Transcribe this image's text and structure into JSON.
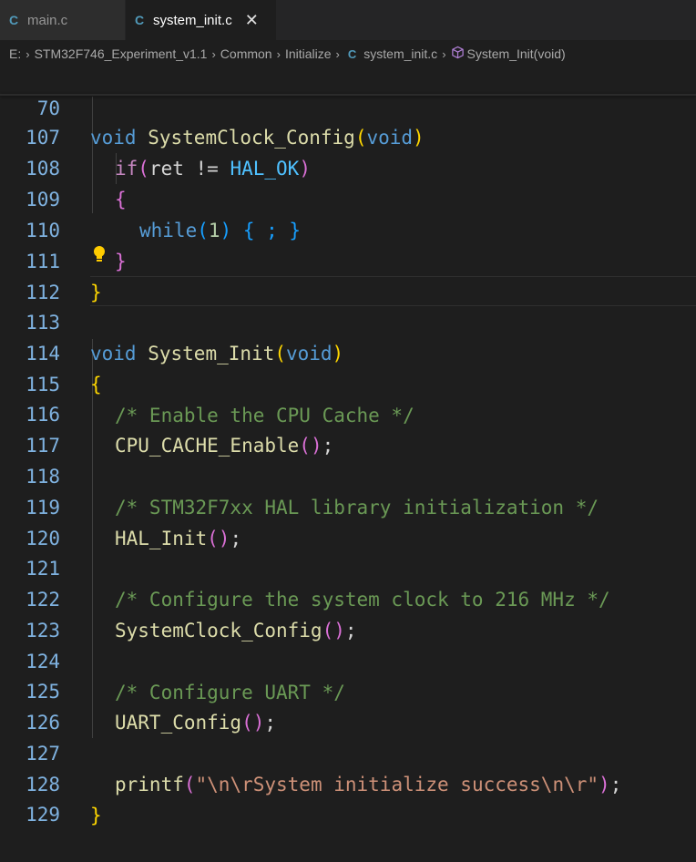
{
  "tabs": [
    {
      "icon": "C",
      "label": "main.c",
      "active": false
    },
    {
      "icon": "C",
      "label": "system_init.c",
      "active": true,
      "close": "✕"
    }
  ],
  "breadcrumb": {
    "drive": "E:",
    "folder1": "STM32F746_Experiment_v1.1",
    "folder2": "Common",
    "folder3": "Initialize",
    "file_icon": "C",
    "file": "system_init.c",
    "symbol": "System_Init(void)"
  },
  "editor": {
    "sticky": {
      "number": "70",
      "kw": "void",
      "fn": "SystemClock_Config",
      "lp": "(",
      "arg": "void",
      "rp": ")"
    },
    "lines": {
      "l107": {
        "number": "107",
        "kw": "if",
        "lp": "(",
        "var": "ret",
        "op": " != ",
        "mac": "HAL_OK",
        "rp": ")"
      },
      "l108": {
        "number": "108",
        "brace": "{"
      },
      "l109": {
        "number": "109",
        "kw": "while",
        "lp": "(",
        "num": "1",
        "rp": ")",
        "body": " { ; }"
      },
      "l110": {
        "number": "110",
        "brace": "}"
      },
      "l111": {
        "number": "111",
        "brace": "}"
      },
      "l112": {
        "number": "112"
      },
      "l113": {
        "number": "113",
        "kw": "void",
        "fn": "System_Init",
        "lp": "(",
        "arg": "void",
        "rp": ")"
      },
      "l114": {
        "number": "114",
        "brace": "{"
      },
      "l115": {
        "number": "115",
        "comment": "/* Enable the CPU Cache */"
      },
      "l116": {
        "number": "116",
        "fn": "CPU_CACHE_Enable",
        "call": "()",
        "semi": ";"
      },
      "l117": {
        "number": "117"
      },
      "l118": {
        "number": "118",
        "comment": "/* STM32F7xx HAL library initialization */"
      },
      "l119": {
        "number": "119",
        "fn": "HAL_Init",
        "call": "()",
        "semi": ";"
      },
      "l120": {
        "number": "120"
      },
      "l121": {
        "number": "121",
        "comment": "/* Configure the system clock to 216 MHz */"
      },
      "l122": {
        "number": "122",
        "fn": "SystemClock_Config",
        "call": "()",
        "semi": ";"
      },
      "l123": {
        "number": "123"
      },
      "l124": {
        "number": "124",
        "comment": "/* Configure UART */"
      },
      "l125": {
        "number": "125",
        "fn": "UART_Config",
        "call": "()",
        "semi": ";"
      },
      "l126": {
        "number": "126"
      },
      "l127": {
        "number": "127",
        "fn": "printf",
        "lp": "(",
        "str": "\"\\n\\rSystem initialize success\\n\\r\"",
        "rp": ")",
        "semi": ";"
      },
      "l128": {
        "number": "128",
        "brace": "}"
      },
      "l129": {
        "number": "129"
      }
    },
    "lightbulb_icon": "lightbulb-icon"
  }
}
